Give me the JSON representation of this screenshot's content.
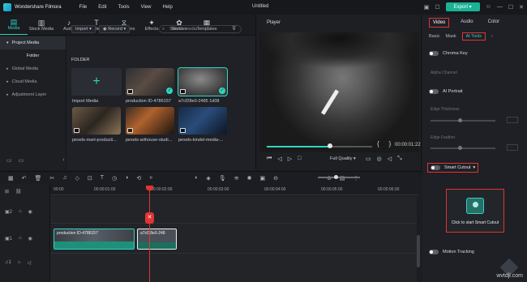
{
  "app": {
    "name": "Wondershare Filmora",
    "doc_title": "Untitled",
    "export_label": "Export"
  },
  "menu": [
    "File",
    "Edit",
    "Tools",
    "View",
    "Help"
  ],
  "media_tabs": [
    {
      "label": "Media",
      "icon": "media-icon",
      "active": true
    },
    {
      "label": "Stock Media",
      "icon": "stock-media-icon"
    },
    {
      "label": "Audio",
      "icon": "audio-icon"
    },
    {
      "label": "Titles",
      "icon": "titles-icon"
    },
    {
      "label": "Transitions",
      "icon": "transitions-icon"
    },
    {
      "label": "Effects",
      "icon": "effects-icon"
    },
    {
      "label": "Stickers",
      "icon": "stickers-icon"
    },
    {
      "label": "Templates",
      "icon": "templates-icon"
    }
  ],
  "sidebar": {
    "items": [
      "Project Media",
      "Folder",
      "Global Media",
      "Cloud Media",
      "Adjustment Layer"
    ]
  },
  "media_toolbar": {
    "import": "Import",
    "record": "Record",
    "search_placeholder": "Search media"
  },
  "folder_label": "FOLDER",
  "media_items": [
    {
      "caption": "Import Media"
    },
    {
      "caption": "production ID-4786157"
    },
    {
      "caption": "a7cf28e0-2485 1d08"
    },
    {
      "caption": "pexels-mart-producti..."
    },
    {
      "caption": "pexels-arthouse-studi..."
    },
    {
      "caption": "pexels-kindel-media-..."
    }
  ],
  "player": {
    "label": "Player",
    "timecode": "00:00:01:22",
    "quality": "Full Quality",
    "progress": 0.6
  },
  "properties": {
    "tabs": [
      "Video",
      "Audio",
      "Color"
    ],
    "active_tab": "Video",
    "sub_tabs": [
      "Basic",
      "Mask",
      "AI Tools"
    ],
    "active_sub_tab": "AI Tools",
    "chroma_key": "Chroma Key",
    "alpha_channel": "Alpha Channel",
    "ai_portrait": "AI Portrait",
    "edge_thickness": "Edge Thickness",
    "edge_feather": "Edge Feather",
    "smart_cutout": "Smart Cutout",
    "smart_cutout_prompt": "Click to start Smart Cutout",
    "motion_tracking": "Motion Tracking"
  },
  "timeline": {
    "ruler": [
      "00:00",
      "00:00:01:00",
      "00:00:02:00",
      "00:00:03:00",
      "00:00:04:00",
      "00:00:05:00",
      "00:00:06:00"
    ],
    "clip_a": "production ID-4786157",
    "clip_b": "a7cf28e0-248"
  },
  "watermark": "wvtdjl.com"
}
